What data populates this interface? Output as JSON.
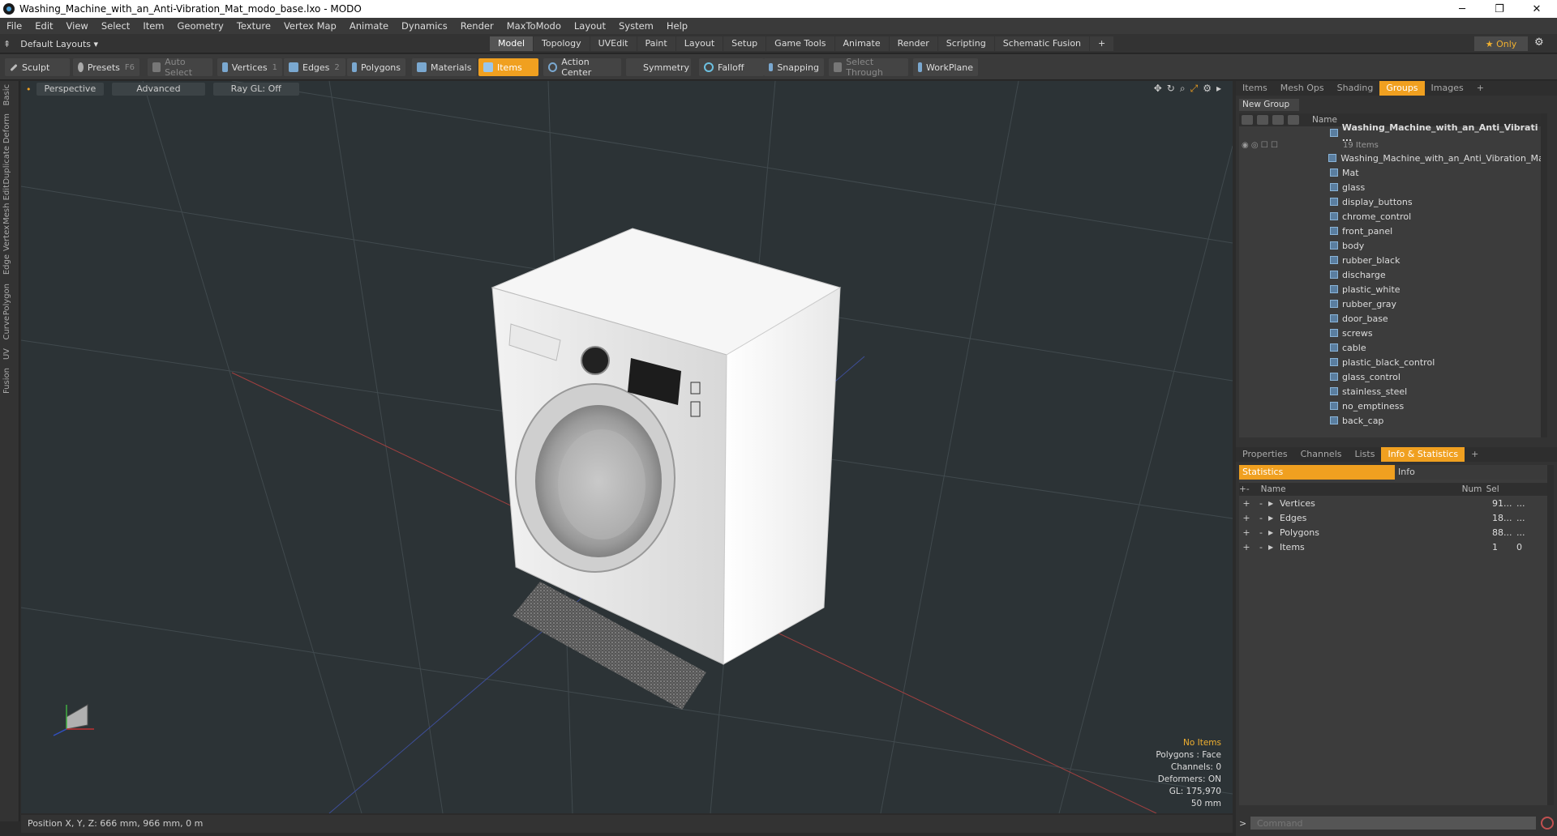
{
  "window": {
    "title": "Washing_Machine_with_an_Anti-Vibration_Mat_modo_base.lxo - MODO",
    "minimize": "─",
    "maximize": "❐",
    "close": "✕"
  },
  "menu": [
    "File",
    "Edit",
    "View",
    "Select",
    "Item",
    "Geometry",
    "Texture",
    "Vertex Map",
    "Animate",
    "Dynamics",
    "Render",
    "MaxToModo",
    "Layout",
    "System",
    "Help"
  ],
  "layouts": {
    "label": "Default Layouts ▾"
  },
  "mode_tabs": [
    "Model",
    "Topology",
    "UVEdit",
    "Paint",
    "Layout",
    "Setup",
    "Game Tools",
    "Animate",
    "Render",
    "Scripting",
    "Schematic Fusion",
    "+"
  ],
  "only_label": "★  Only",
  "toolbar": {
    "sculpt": "Sculpt",
    "presets": "Presets",
    "presets_key": "F6",
    "auto_select": "Auto Select",
    "vertices": "Vertices",
    "vertices_key": "1",
    "edges": "Edges",
    "edges_key": "2",
    "polygons": "Polygons",
    "materials": "Materials",
    "items": "Items",
    "action_center": "Action Center",
    "symmetry": "Symmetry",
    "falloff": "Falloff",
    "snapping": "Snapping",
    "select_through": "Select Through",
    "workplane": "WorkPlane"
  },
  "left_tabs": [
    "Basic",
    "Deform",
    "Duplicate",
    "Mesh Edit",
    "Vertex",
    "Edge",
    "Polygon",
    "Curve",
    "UV",
    "Fusion"
  ],
  "viewport": {
    "view": "Perspective",
    "shading": "Advanced",
    "raygl": "Ray GL: Off",
    "info": {
      "no_items": "No Items",
      "polygons": "Polygons : Face",
      "channels": "Channels: 0",
      "deformers": "Deformers: ON",
      "gl": "GL: 175,970",
      "scale": "50 mm"
    }
  },
  "status": "Position X, Y, Z:   666 mm, 966 mm, 0 m",
  "groups_panel": {
    "tabs": [
      "Items",
      "Mesh Ops",
      "Shading",
      "Groups",
      "Images",
      "+"
    ],
    "new_group": "New Group",
    "col_name": "Name",
    "root": "Washing_Machine_with_an_Anti_Vibrati ...",
    "root_count": "19 Items",
    "items": [
      "Washing_Machine_with_an_Anti_Vibration_Mat",
      "Mat",
      "glass",
      "display_buttons",
      "chrome_control",
      "front_panel",
      "body",
      "rubber_black",
      "discharge",
      "plastic_white",
      "rubber_gray",
      "door_base",
      "screws",
      "cable",
      "plastic_black_control",
      "glass_control",
      "stainless_steel",
      "no_emptiness",
      "back_cap"
    ]
  },
  "stats_panel": {
    "tabs": [
      "Properties",
      "Channels",
      "Lists",
      "Info & Statistics",
      "+"
    ],
    "subtabs": [
      "Statistics",
      "Info"
    ],
    "cols": [
      "Name",
      "Num",
      "Sel"
    ],
    "rows": [
      {
        "name": "Vertices",
        "num": "91...",
        "sel": "..."
      },
      {
        "name": "Edges",
        "num": "18...",
        "sel": "..."
      },
      {
        "name": "Polygons",
        "num": "88...",
        "sel": "..."
      },
      {
        "name": "Items",
        "num": "1",
        "sel": "0"
      }
    ]
  },
  "command_placeholder": "Command"
}
